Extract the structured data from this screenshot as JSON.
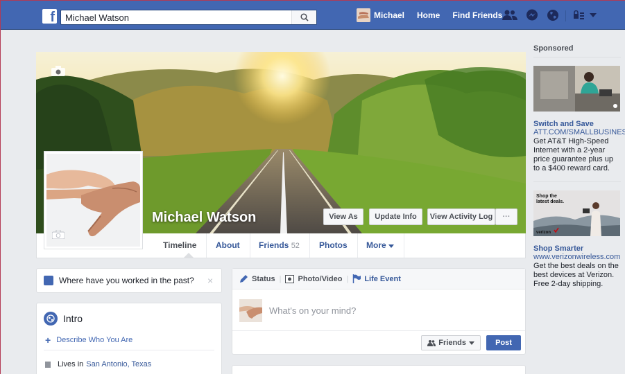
{
  "topbar": {
    "search_value": "Michael Watson",
    "user_name": "Michael",
    "home": "Home",
    "find_friends": "Find Friends"
  },
  "cover": {
    "name": "Michael Watson",
    "view_as": "View As",
    "update_info": "Update Info",
    "view_activity_log": "View Activity Log",
    "more": "···"
  },
  "tabs": {
    "timeline": "Timeline",
    "about": "About",
    "friends": "Friends",
    "friends_count": "52",
    "photos": "Photos",
    "more": "More"
  },
  "work_prompt": {
    "text": "Where have you worked in the past?",
    "close": "×"
  },
  "intro": {
    "title": "Intro",
    "describe_link": "Describe Who You Are",
    "lives_in_label": "Lives in",
    "lives_in_city": "San Antonio, Texas"
  },
  "composer": {
    "status": "Status",
    "photo_video": "Photo/Video",
    "life_event": "Life Event",
    "placeholder": "What's on your mind?",
    "audience": "Friends",
    "post": "Post"
  },
  "sponsored": {
    "heading": "Sponsored",
    "ads": [
      {
        "title": "Switch and Save",
        "url": "ATT.COM/SMALLBUSINESS",
        "desc": "Get AT&T High-Speed Internet with a 2-year price guarantee plus up to a $400 reward card."
      },
      {
        "image_text": "Shop the latest deals.",
        "title": "Shop Smarter",
        "url": "www.verizonwireless.com",
        "desc": "Get the best deals on the best devices at Verizon. Free 2-day shipping."
      }
    ]
  },
  "colors": {
    "brand_blue": "#4267b2",
    "link_blue": "#365899",
    "page_bg": "#e9ebee"
  }
}
